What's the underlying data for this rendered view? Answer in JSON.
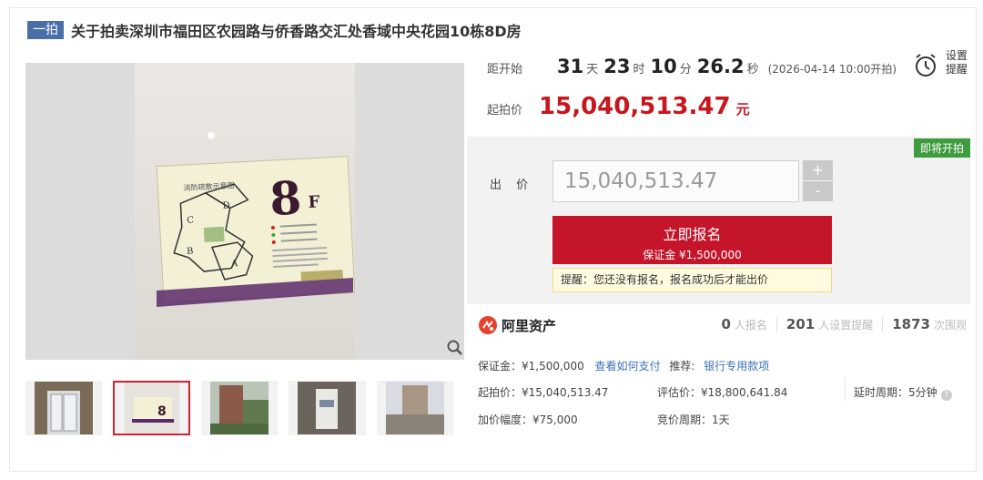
{
  "title": {
    "round_badge": "一拍",
    "text": "关于拍卖深圳市福田区农园路与侨香路交汇处香域中央花园10栋8D房"
  },
  "image": {
    "sign_title": "消防疏散示意图",
    "sign_floor": "8",
    "sign_floor_suffix": "F",
    "zones": [
      "C",
      "D",
      "B",
      "A"
    ]
  },
  "countdown": {
    "label": "距开始",
    "days": "31",
    "days_unit": "天",
    "hours": "23",
    "hours_unit": "时",
    "minutes": "10",
    "minutes_unit": "分",
    "seconds": "26.2",
    "seconds_unit": "秒",
    "start_time": "(2026-04-14 10:00开拍)"
  },
  "reminder": {
    "line1": "设置",
    "line2": "提醒"
  },
  "start_price": {
    "label": "起拍价",
    "value": "15,040,513.47",
    "unit": "元"
  },
  "bid": {
    "status_badge": "即将开拍",
    "label": "出 价",
    "input_value": "15,040,513.47",
    "plus": "+",
    "minus": "-",
    "signup_main": "立即报名",
    "signup_sub": "保证金 ¥1,500,000",
    "tip": "提醒：您还没有报名，报名成功后才能出价"
  },
  "platform": {
    "name": "阿里资产"
  },
  "stats": {
    "signup_count": "0",
    "signup_label": "人报名",
    "remind_count": "201",
    "remind_label": "人设置提醒",
    "view_count": "1873",
    "view_label": "次围观"
  },
  "info": {
    "deposit": "保证金：¥1,500,000",
    "pay_link": "查看如何支付",
    "recommend_label": "推荐:",
    "recommend_link": "银行专用款项",
    "start_price": "起拍价：¥15,040,513.47",
    "appraisal": "评估价：¥18,800,641.84",
    "delay_period": "延时周期：5分钟",
    "increment": "加价幅度：¥75,000",
    "bid_period": "竞价周期：1天"
  },
  "colors": {
    "accent_red": "#c5152b",
    "price_red": "#c8161d",
    "badge_blue": "#4a6ea8",
    "badge_green": "#3e9b3e",
    "link_blue": "#3a6fb7"
  }
}
